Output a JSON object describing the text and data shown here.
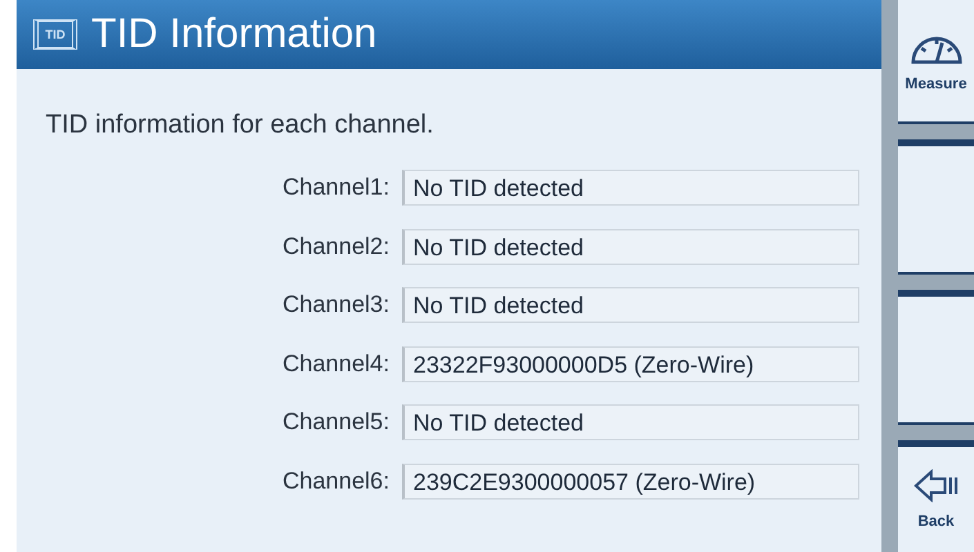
{
  "header": {
    "icon_label": "TID",
    "title": "TID Information"
  },
  "intro": "TID information for each channel.",
  "channels": [
    {
      "label": "Channel1:",
      "value": "No TID detected"
    },
    {
      "label": "Channel2:",
      "value": "No TID detected"
    },
    {
      "label": "Channel3:",
      "value": "No TID detected"
    },
    {
      "label": "Channel4:",
      "value": "23322F93000000D5 (Zero-Wire)"
    },
    {
      "label": "Channel5:",
      "value": "No TID detected"
    },
    {
      "label": "Channel6:",
      "value": "239C2E9300000057 (Zero-Wire)"
    }
  ],
  "side_buttons": [
    {
      "kind": "measure",
      "label": "Measure"
    },
    {
      "kind": "blank"
    },
    {
      "kind": "blank"
    },
    {
      "kind": "back",
      "label": "Back"
    }
  ]
}
